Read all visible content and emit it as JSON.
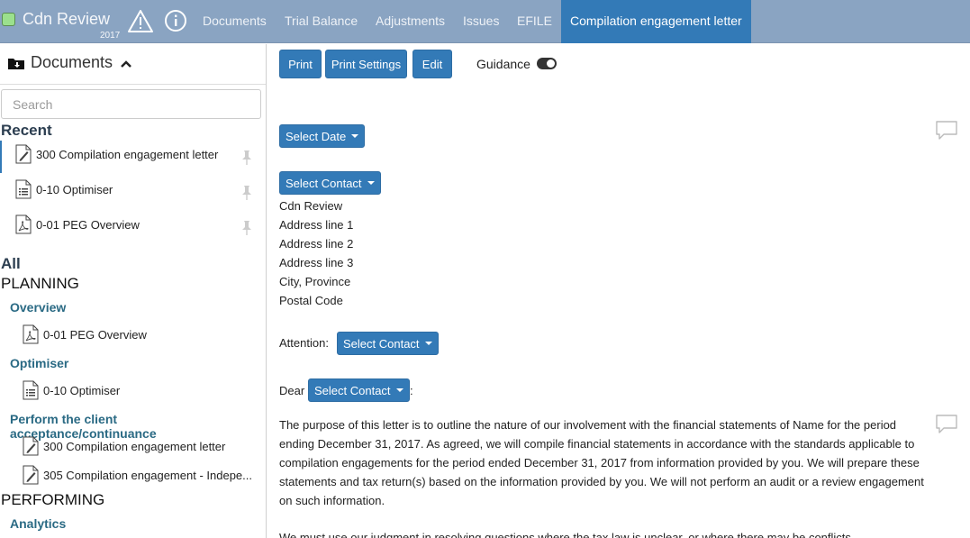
{
  "header": {
    "app_title": "Cdn Review",
    "year": "2017",
    "tabs": [
      {
        "label": "Documents"
      },
      {
        "label": "Trial Balance"
      },
      {
        "label": "Adjustments"
      },
      {
        "label": "Issues"
      },
      {
        "label": "EFILE"
      },
      {
        "label": "Compilation engagement letter",
        "active": true
      }
    ],
    "status_color": "#9be08d",
    "accent_color": "#337ab7"
  },
  "sidebar": {
    "title": "Documents",
    "search_placeholder": "Search",
    "recent_heading": "Recent",
    "recent": [
      {
        "label": "300 Compilation engagement letter",
        "icon": "edit-document-icon"
      },
      {
        "label": "0-10 Optimiser",
        "icon": "list-document-icon"
      },
      {
        "label": "0-01 PEG Overview",
        "icon": "pdf-document-icon"
      }
    ],
    "all_heading": "All",
    "groups": [
      {
        "label": "PLANNING"
      },
      {
        "label": "PERFORMING"
      }
    ],
    "categories": [
      {
        "label": "Overview",
        "items": [
          {
            "label": "0-01 PEG Overview",
            "icon": "pdf-document-icon"
          }
        ]
      },
      {
        "label": "Optimiser",
        "items": [
          {
            "label": "0-10 Optimiser",
            "icon": "list-document-icon"
          }
        ]
      },
      {
        "label": "Perform the client acceptance/continuance",
        "items": [
          {
            "label": "300 Compilation engagement letter",
            "icon": "edit-document-icon"
          },
          {
            "label": "305 Compilation engagement - Indepe...",
            "icon": "edit-document-icon"
          }
        ]
      },
      {
        "label": "Analytics",
        "items": []
      }
    ]
  },
  "toolbar": {
    "print": "Print",
    "print_settings": "Print Settings",
    "edit": "Edit",
    "guidance": "Guidance"
  },
  "letter": {
    "select_date": "Select Date",
    "select_contact": "Select Contact",
    "address": [
      "Cdn Review",
      "Address line 1",
      "Address line 2",
      "Address line 3",
      "City, Province",
      "Postal Code"
    ],
    "attention_label": "Attention:",
    "dear_label": "Dear",
    "dear_suffix": ":",
    "paragraph1": "The purpose of this letter is to outline the nature of our involvement with the financial statements of Name for the period ending December 31, 2017. As agreed, we will compile financial statements in accordance with the standards applicable to compilation engagements for the period ended December 31, 2017 from information provided by you. We will prepare these statements and tax return(s) based on the information provided by you. We will not perform an audit or a review engagement on such information.",
    "paragraph2": "We must use our judgment in resolving questions where the tax law is unclear, or where there may be conflicts"
  }
}
